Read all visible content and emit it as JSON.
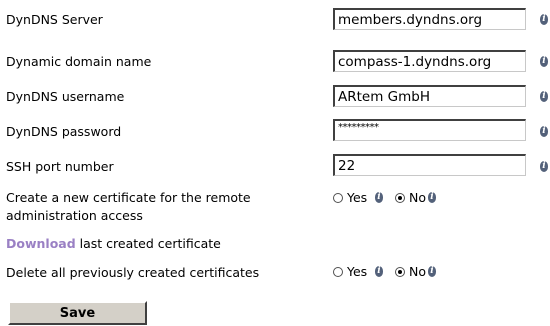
{
  "fields": [
    {
      "label": "DynDNS Server",
      "value": "members.dyndns.org"
    },
    {
      "label": "Dynamic domain name",
      "value": "compass-1.dyndns.org"
    },
    {
      "label": "DynDNS username",
      "value": "ARtem GmbH"
    },
    {
      "label": "DynDNS password",
      "value": "*********"
    },
    {
      "label": "SSH port number",
      "value": "22"
    }
  ],
  "info_icon": "i",
  "certificate": {
    "label_line1": "Create a new certificate for the remote",
    "label_line2": "administration access",
    "options": [
      {
        "label": "Yes",
        "selected": false
      },
      {
        "label": "No",
        "selected": true
      }
    ]
  },
  "download": {
    "link": "Download",
    "text": " last created certificate"
  },
  "delete_certs": {
    "label": "Delete all previously created certificates",
    "options": [
      {
        "label": "Yes",
        "selected": false
      },
      {
        "label": "No",
        "selected": true
      }
    ]
  },
  "save_label": "Save",
  "colors": {
    "link": "#9a80c4",
    "info_icon": "#53617a",
    "button_face": "#d4d0c8"
  }
}
